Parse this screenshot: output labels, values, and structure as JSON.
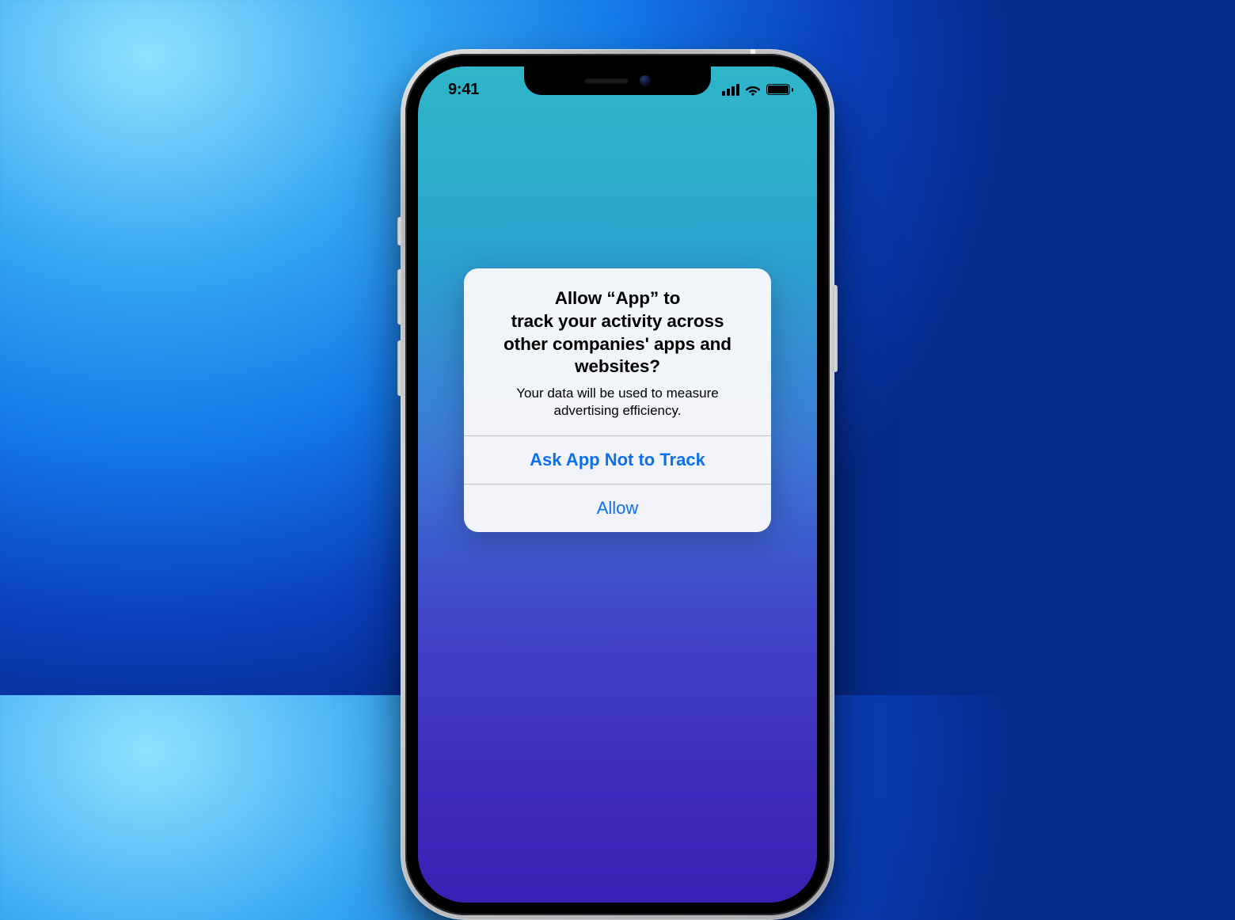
{
  "status_bar": {
    "time": "9:41"
  },
  "alert": {
    "title": "Allow “App” to track your activity across other companies' apps and websites?",
    "message": "Your data will be used to measure advertising efficiency.",
    "deny_label": "Ask App Not to Track",
    "allow_label": "Allow"
  }
}
